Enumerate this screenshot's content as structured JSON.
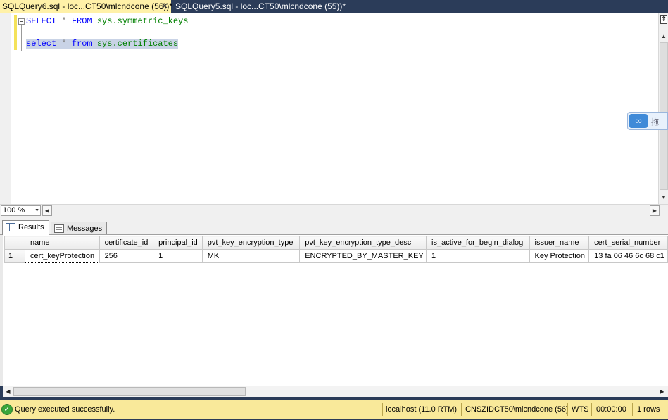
{
  "tabs": [
    {
      "label": "SQLQuery6.sql - loc...CT50\\mlcndcone (56))*",
      "close": "✕"
    },
    {
      "label": "SQLQuery5.sql - loc...CT50\\mlcndcone (55))*"
    }
  ],
  "editor": {
    "line1": {
      "kw1": "SELECT",
      "star": "*",
      "kw2": "FROM",
      "obj": "sys.symmetric_keys"
    },
    "line2": {
      "kw1": "select",
      "star": "*",
      "kw2": "from",
      "obj": "sys.certificates"
    },
    "float_widget_text": "拖",
    "split_icon": "⇕"
  },
  "zoom": {
    "value": "100 %"
  },
  "result_tabs": {
    "results": "Results",
    "messages": "Messages"
  },
  "grid": {
    "columns": [
      "name",
      "certificate_id",
      "principal_id",
      "pvt_key_encryption_type",
      "pvt_key_encryption_type_desc",
      "is_active_for_begin_dialog",
      "issuer_name",
      "cert_serial_number"
    ],
    "rows": [
      {
        "num": "1",
        "cells": [
          "cert_keyProtection",
          "256",
          "1",
          "MK",
          "ENCRYPTED_BY_MASTER_KEY",
          "1",
          "Key Protection",
          "13 fa 06 46 6c 68 c1"
        ]
      }
    ]
  },
  "status": {
    "message": "Query executed successfully.",
    "server": "localhost (11.0 RTM)",
    "user": "CNSZIDCT50\\mlcndcone (56)",
    "database": "WTS",
    "elapsed": "00:00:00",
    "rows": "1 rows"
  },
  "colors": {
    "active_tab": "#fff1a8",
    "chrome": "#2b3c59",
    "status_bar": "#f9e99a",
    "keyword": "#0000ff",
    "object": "#008000"
  }
}
